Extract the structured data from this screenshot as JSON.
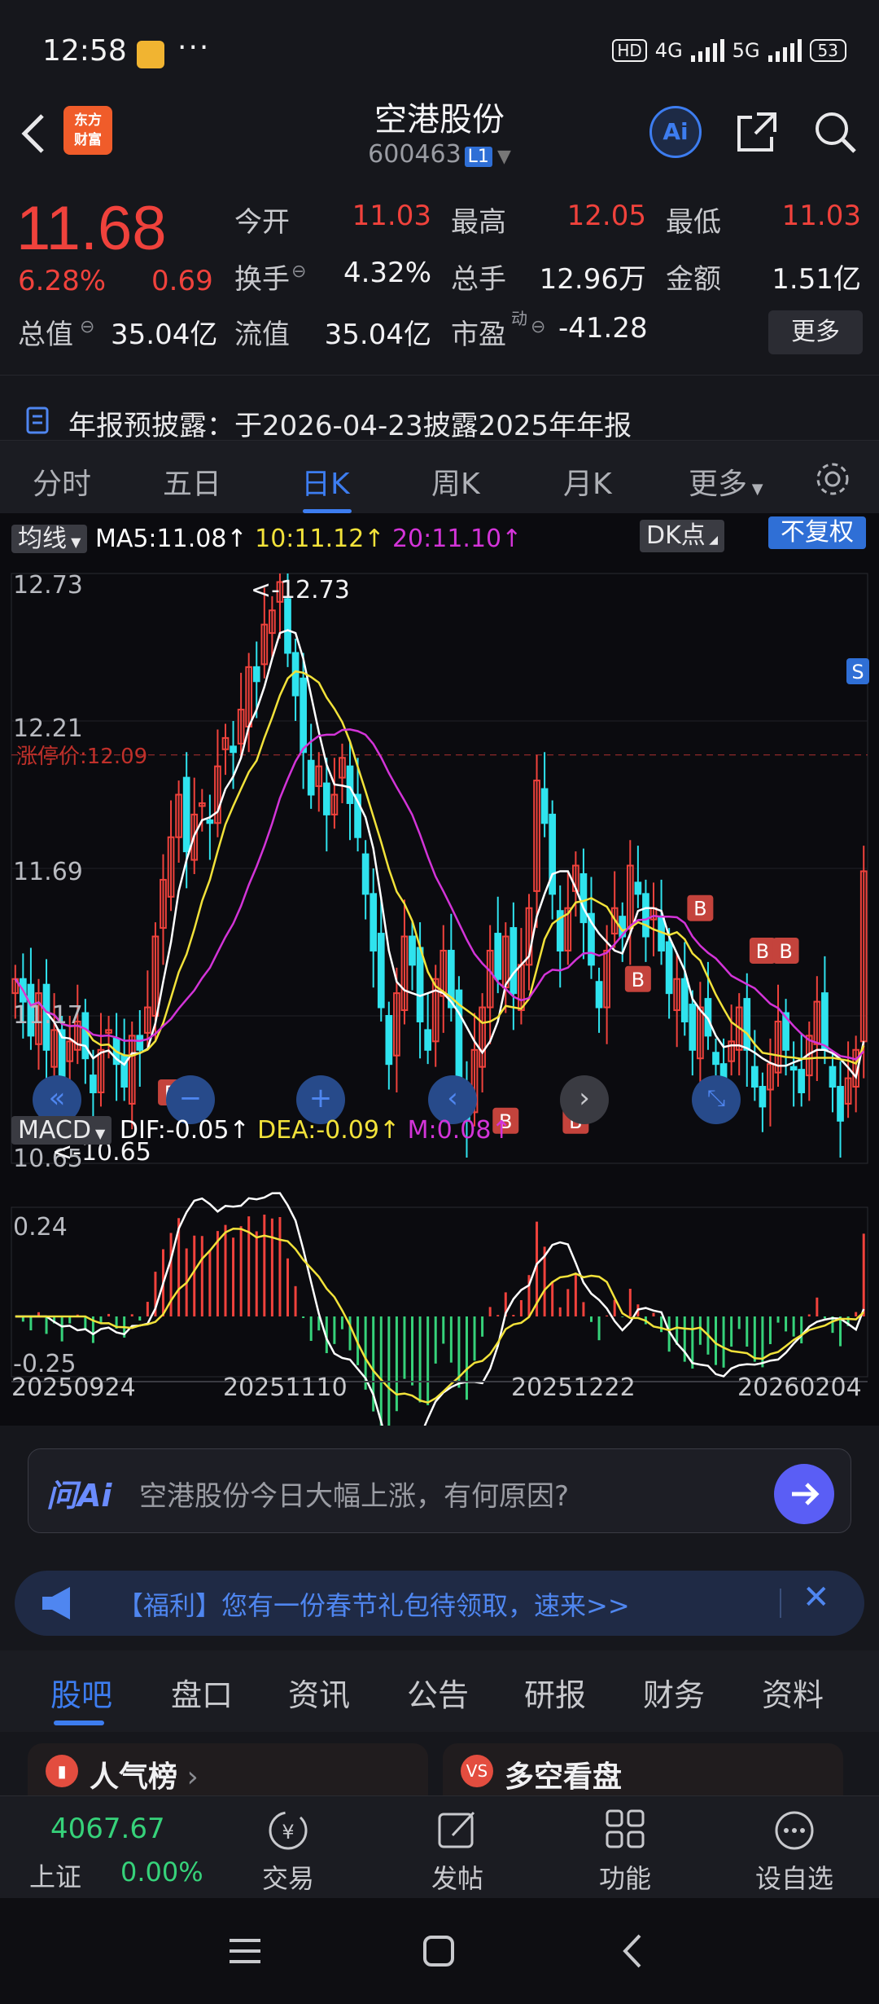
{
  "status": {
    "time": "12:58",
    "net1": "4G",
    "net2": "5G",
    "battery": "53",
    "hd": "HD"
  },
  "header": {
    "title": "空港股份",
    "code": "600463",
    "level": "L1",
    "logo_line1": "东方",
    "logo_line2": "财富",
    "ai": "Ai"
  },
  "quote": {
    "price": "11.68",
    "pct": "6.28%",
    "change": "0.69",
    "open_label": "今开",
    "open": "11.03",
    "high_label": "最高",
    "high": "12.05",
    "low_label": "最低",
    "low": "11.03",
    "turnover_label": "换手",
    "turnover": "4.32%",
    "volume_label": "总手",
    "volume": "12.96万",
    "amount_label": "金额",
    "amount": "1.51亿",
    "mcap_label": "总值",
    "mcap": "35.04亿",
    "float_label": "流值",
    "float": "35.04亿",
    "pe_label": "市盈",
    "pe_sup": "动",
    "pe": "-41.28",
    "more": "更多"
  },
  "notice": "年报预披露：于2026-04-23披露2025年年报",
  "ktabs": [
    "分时",
    "五日",
    "日K",
    "周K",
    "月K",
    "更多"
  ],
  "chart": {
    "ma_select": "均线",
    "ma5": "MA5:11.08",
    "ma10": "10:11.12",
    "ma20": "20:11.10",
    "dk": "DK点",
    "fq": "不复权",
    "y_labels": [
      "12.73",
      "12.21",
      "11.69",
      "11.17",
      "10.65"
    ],
    "max_note": "<-12.73",
    "min_note": "<-10.65",
    "limit_label": "涨停价:12.09",
    "macd_select": "MACD",
    "dif": "DIF:-0.05",
    "dea": "DEA:-0.09",
    "m": "M:0.08",
    "macd_y": [
      "0.24",
      "-0.25"
    ],
    "dates": [
      "20250924",
      "20251110",
      "20251222",
      "20260204"
    ],
    "markers": [
      "B",
      "B",
      "B",
      "B",
      "B",
      "B",
      "B",
      "S"
    ]
  },
  "chart_data": {
    "type": "candlestick",
    "ylim": [
      10.65,
      12.73
    ],
    "limit_price": 12.09,
    "x_start": "20250924",
    "x_end": "20260204",
    "indicators": {
      "MA5": 11.08,
      "MA10": 11.12,
      "MA20": 11.1,
      "DIF": -0.05,
      "DEA": -0.09,
      "M": 0.08
    },
    "macd_ylim": [
      -0.25,
      0.24
    ],
    "close_series": [
      11.3,
      11.22,
      11.1,
      11.25,
      11.05,
      11.12,
      10.95,
      11.08,
      11.15,
      11.02,
      10.9,
      11.05,
      11.12,
      11.0,
      10.92,
      11.1,
      11.05,
      11.2,
      11.45,
      11.65,
      11.8,
      11.95,
      11.75,
      11.88,
      11.92,
      11.85,
      12.05,
      12.15,
      12.1,
      12.25,
      12.4,
      12.35,
      12.55,
      12.6,
      12.7,
      12.45,
      12.3,
      12.1,
      11.95,
      12.05,
      11.88,
      11.95,
      12.08,
      11.92,
      11.8,
      11.6,
      11.4,
      11.2,
      11.0,
      11.25,
      11.45,
      11.35,
      11.15,
      11.05,
      11.3,
      11.4,
      11.2,
      10.95,
      10.8,
      11.05,
      11.2,
      11.4,
      11.3,
      11.45,
      11.25,
      11.35,
      11.55,
      12.0,
      11.85,
      11.6,
      11.4,
      11.55,
      11.7,
      11.5,
      11.35,
      11.2,
      11.4,
      11.55,
      11.45,
      11.7,
      11.6,
      11.45,
      11.55,
      11.4,
      11.25,
      11.3,
      11.15,
      11.05,
      11.2,
      11.1,
      11.0,
      10.95,
      11.08,
      11.2,
      11.05,
      10.92,
      10.85,
      11.0,
      11.15,
      11.05,
      10.98,
      10.9,
      11.1,
      11.22,
      11.05,
      10.92,
      10.8,
      10.95,
      11.05,
      11.68
    ]
  },
  "ask_ai": {
    "brand": "问Ai",
    "question": "空港股份今日大幅上涨，有何原因?"
  },
  "promo": "【福利】您有一份春节礼包待领取，速来>>",
  "btabs": [
    "股吧",
    "盘口",
    "资讯",
    "公告",
    "研报",
    "财务",
    "资料"
  ],
  "cards": [
    "人气榜",
    "多空看盘"
  ],
  "bottom": {
    "index_value": "4067.67",
    "index_name": "上证",
    "index_pct": "0.00%",
    "nav": [
      "交易",
      "发帖",
      "功能",
      "设自选"
    ]
  },
  "colors": {
    "up": "#f0423c",
    "down": "#2fe3ee",
    "accent": "#3d7df0",
    "ma5": "#ffffff",
    "ma10": "#f2e23a",
    "ma20": "#d334d8"
  }
}
